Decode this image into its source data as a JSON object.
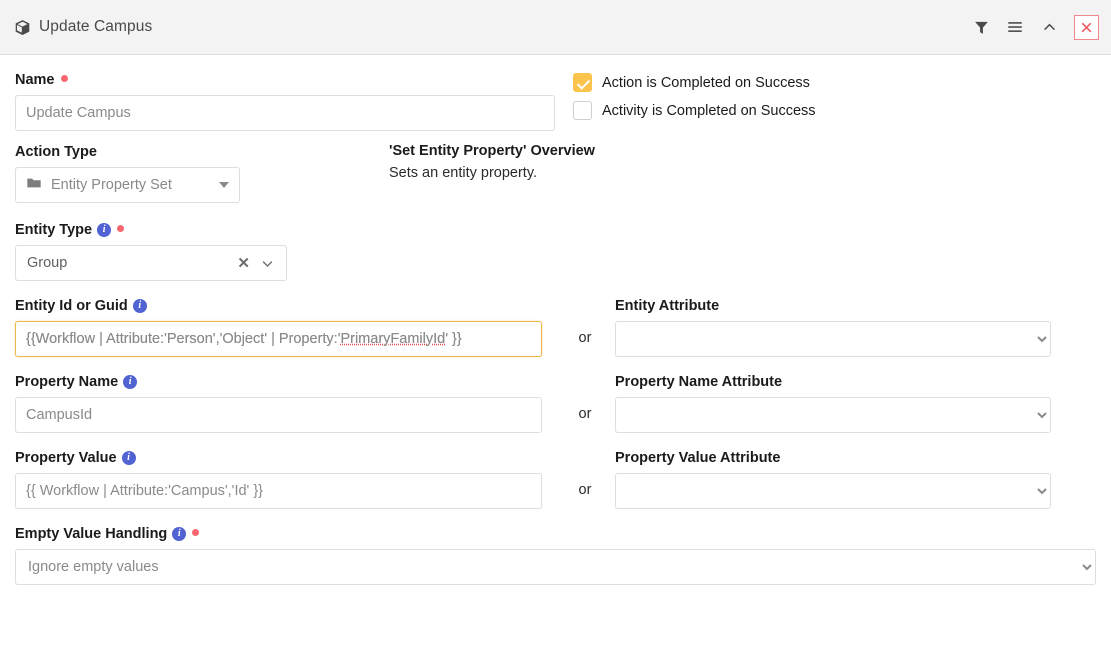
{
  "header": {
    "title": "Update Campus",
    "icon": "cube-icon",
    "actions": [
      {
        "name": "filter-icon",
        "label": "Filter"
      },
      {
        "name": "menu-icon",
        "label": "Menu"
      },
      {
        "name": "chevron-up-icon",
        "label": "Collapse"
      },
      {
        "name": "close-icon",
        "label": "Close"
      }
    ],
    "close_color": "#f0868e"
  },
  "form": {
    "name": {
      "label": "Name",
      "required": true,
      "placeholder": "Update Campus",
      "value": ""
    },
    "checkboxes": [
      {
        "label": "Action is Completed on Success",
        "checked": true
      },
      {
        "label": "Activity is Completed on Success",
        "checked": false
      }
    ],
    "action_type": {
      "label": "Action Type",
      "value": "Entity Property Set",
      "icon": "folder-icon"
    },
    "overview": {
      "title": "'Set Entity Property' Overview",
      "text": "Sets an entity property."
    },
    "entity_type": {
      "label": "Entity Type",
      "required": true,
      "info": true,
      "value": "Group",
      "clear_icon": "close-icon",
      "arrow_icon": "chevron-down-icon"
    },
    "entity_id_or_guid": {
      "label": "Entity Id or Guid",
      "info": true,
      "placeholder": "{{Workflow | Attribute:'Person','Object' | Property:'PrimaryFamilyId' }}",
      "placeholder_prefix": "{{Workflow | Attribute:'Person','Object' | Property:'",
      "placeholder_spell": "PrimaryFamilyId",
      "placeholder_suffix": "' }}",
      "focused": true,
      "focus_color": "#edb84c"
    },
    "entity_attribute": {
      "label": "Entity Attribute",
      "value": "",
      "options": [
        ""
      ]
    },
    "property_name": {
      "label": "Property Name",
      "info": true,
      "placeholder": "CampusId",
      "value": ""
    },
    "property_name_attribute": {
      "label": "Property Name Attribute",
      "value": "",
      "options": [
        ""
      ]
    },
    "property_value": {
      "label": "Property Value",
      "info": true,
      "placeholder": "{{ Workflow | Attribute:'Campus','Id' }}",
      "value": ""
    },
    "property_value_attribute": {
      "label": "Property Value Attribute",
      "value": "",
      "options": [
        ""
      ]
    },
    "empty_value_handling": {
      "label": "Empty Value Handling",
      "info": true,
      "required": true,
      "value": "Ignore empty values",
      "options": [
        "Ignore empty values"
      ]
    },
    "or_label": "or"
  }
}
